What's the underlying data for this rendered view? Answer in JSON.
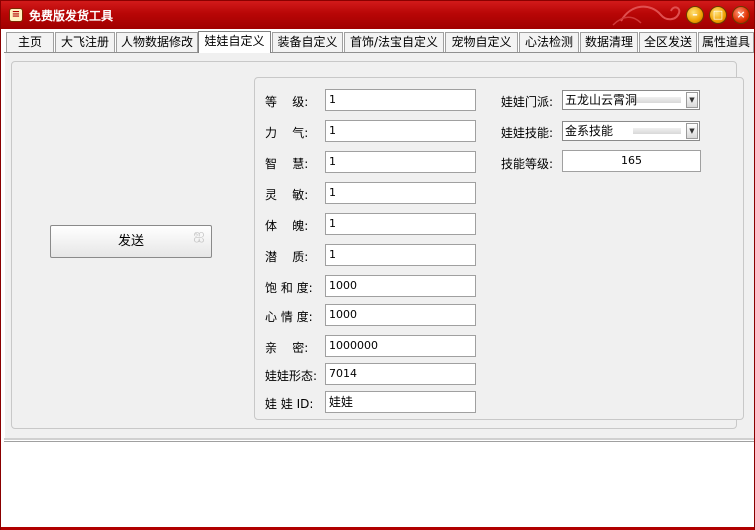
{
  "window": {
    "title": "免费版发货工具",
    "icon": "app-icon",
    "controls": [
      "minimize-icon",
      "maximize-icon",
      "close-icon"
    ]
  },
  "tabs": [
    {
      "label": "主页"
    },
    {
      "label": "大飞注册"
    },
    {
      "label": "人物数据修改"
    },
    {
      "label": "娃娃自定义",
      "active": true
    },
    {
      "label": "装备自定义"
    },
    {
      "label": "首饰/法宝自定义"
    },
    {
      "label": "宠物自定义"
    },
    {
      "label": "心法检测"
    },
    {
      "label": "数据清理"
    },
    {
      "label": "全区发送"
    },
    {
      "label": "属性道具"
    }
  ],
  "send_button": {
    "label": "发送"
  },
  "fields": [
    {
      "label": "等    级:",
      "value": "1"
    },
    {
      "label": "力    气:",
      "value": "1"
    },
    {
      "label": "智    慧:",
      "value": "1"
    },
    {
      "label": "灵    敏:",
      "value": "1"
    },
    {
      "label": "体    魄:",
      "value": "1"
    },
    {
      "label": "潜    质:",
      "value": "1"
    },
    {
      "label": "饱 和 度:",
      "value": "1000"
    },
    {
      "label": "心 情 度:",
      "value": "1000"
    },
    {
      "label": "亲    密:",
      "value": "1000000"
    },
    {
      "label": "娃娃形态:",
      "value": "7014"
    },
    {
      "label": "娃 娃 ID:",
      "value": "娃娃"
    }
  ],
  "right": {
    "sect_label": "娃娃门派:",
    "sect_value": "五龙山云霄洞",
    "skill_label": "娃娃技能:",
    "skill_value": "金系技能",
    "skill_level_label": "技能等级:",
    "skill_level_value": "165"
  },
  "colors": {
    "titlebar": "#b80606",
    "panel_bg": "#f0f0f0"
  }
}
